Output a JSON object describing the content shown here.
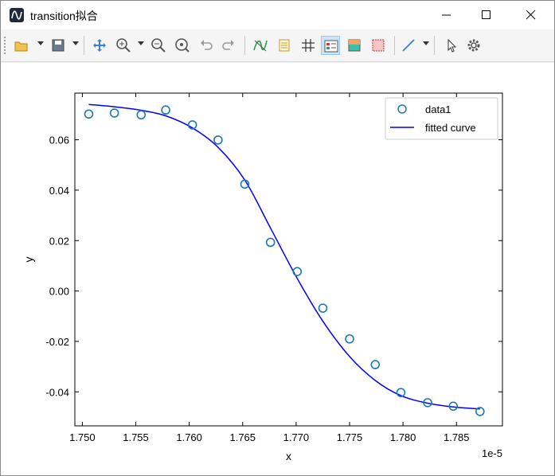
{
  "window": {
    "title": "transition拟合"
  },
  "toolbar": {
    "icons": [
      "open-folder-icon",
      "save-icon",
      "pan-icon",
      "zoom-in-icon",
      "zoom-out-icon",
      "zoom-fit-icon",
      "undo-icon",
      "redo-icon",
      "curve-fit-icon",
      "data-table-icon",
      "grid-icon",
      "legend-icon",
      "color-fill-icon",
      "border-icon",
      "line-tool-icon",
      "select-arrow-icon",
      "settings-gear-icon"
    ]
  },
  "colors": {
    "marker": "#1f77b4",
    "fitted_curve": "#0000ff",
    "toolbar_active_bg": "#cce4f7"
  },
  "chart_data": {
    "type": "scatter",
    "title": "",
    "xlabel": "x",
    "ylabel": "y",
    "x_offset_label": "1e-5",
    "xlim": [
      1.7493,
      1.7893
    ],
    "ylim": [
      -0.0535,
      0.0785
    ],
    "xticks": [
      1.75,
      1.755,
      1.76,
      1.765,
      1.77,
      1.775,
      1.78,
      1.785
    ],
    "xtick_labels": [
      "1.750",
      "1.755",
      "1.760",
      "1.765",
      "1.770",
      "1.775",
      "1.780",
      "1.785"
    ],
    "yticks": [
      0.06,
      0.04,
      0.02,
      0.0,
      -0.02,
      -0.04
    ],
    "ytick_labels": [
      "0.06",
      "0.04",
      "0.02",
      "0.00",
      "-0.02",
      "-0.04"
    ],
    "legend": {
      "position": "top-right",
      "entries": [
        "data1",
        "fitted curve"
      ]
    },
    "series": [
      {
        "name": "data1",
        "kind": "markers",
        "x": [
          1.7506,
          1.753,
          1.7555,
          1.7578,
          1.7603,
          1.7627,
          1.7652,
          1.7676,
          1.7701,
          1.7725,
          1.775,
          1.7774,
          1.7798,
          1.7823,
          1.7847,
          1.7872
        ],
        "y": [
          0.0702,
          0.0706,
          0.0699,
          0.0718,
          0.0659,
          0.0599,
          0.0424,
          0.0193,
          0.0077,
          -0.0068,
          -0.019,
          -0.0292,
          -0.0403,
          -0.0443,
          -0.0457,
          -0.0478
        ]
      },
      {
        "name": "fitted curve",
        "kind": "line",
        "x": [
          1.7506,
          1.753,
          1.7555,
          1.7578,
          1.7603,
          1.7627,
          1.7652,
          1.7676,
          1.7701,
          1.7725,
          1.775,
          1.7774,
          1.7798,
          1.7823,
          1.7847,
          1.7872
        ],
        "y": [
          0.074,
          0.0731,
          0.0717,
          0.0695,
          0.0647,
          0.057,
          0.044,
          0.025,
          0.005,
          -0.012,
          -0.026,
          -0.0355,
          -0.0415,
          -0.0445,
          -0.046,
          -0.0468
        ]
      }
    ]
  }
}
